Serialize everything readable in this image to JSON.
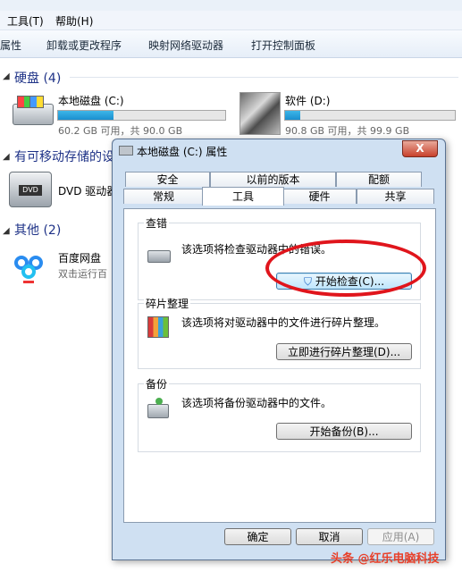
{
  "menubar": {
    "items": [
      "工具(T)",
      "帮助(H)"
    ]
  },
  "toolbar": {
    "items": [
      "属性",
      "卸载或更改程序",
      "映射网络驱动器",
      "打开控制面板"
    ]
  },
  "groups": {
    "hard_disk": "硬盘 (4)",
    "removable": "有可移动存储的设",
    "other": "其他 (2)"
  },
  "drives": [
    {
      "name": "本地磁盘 (C:)",
      "detail": "60.2 GB 可用，共 90.0 GB",
      "used_fraction": 0.33
    },
    {
      "name": "软件 (D:)",
      "detail": "90.8 GB 可用，共 99.9 GB",
      "used_fraction": 0.09
    }
  ],
  "dvd": {
    "name": "DVD 驱动器",
    "icon": "dvd-drive-icon"
  },
  "baidu": {
    "name": "百度网盘",
    "sub": "双击运行百"
  },
  "dialog": {
    "title": "本地磁盘 (C:) 属性",
    "close_label": "X",
    "tabs_row1": [
      "安全",
      "以前的版本",
      "配额"
    ],
    "tabs_row2": [
      "常规",
      "工具",
      "硬件",
      "共享"
    ],
    "active_tab": "工具",
    "sections": [
      {
        "legend": "查错",
        "desc": "该选项将检查驱动器中的错误。",
        "button": "开始检查(C)..."
      },
      {
        "legend": "碎片整理",
        "desc": "该选项将对驱动器中的文件进行碎片整理。",
        "button": "立即进行碎片整理(D)..."
      },
      {
        "legend": "备份",
        "desc": "该选项将备份驱动器中的文件。",
        "button": "开始备份(B)..."
      }
    ],
    "buttons": {
      "ok": "确定",
      "cancel": "取消",
      "apply": "应用(A)"
    }
  },
  "watermark": "头条 @红乐电脑科技",
  "colors": {
    "accent_bar": "#1a8fcf",
    "highlight_red": "#e0151c",
    "group_text": "#1e3287"
  }
}
